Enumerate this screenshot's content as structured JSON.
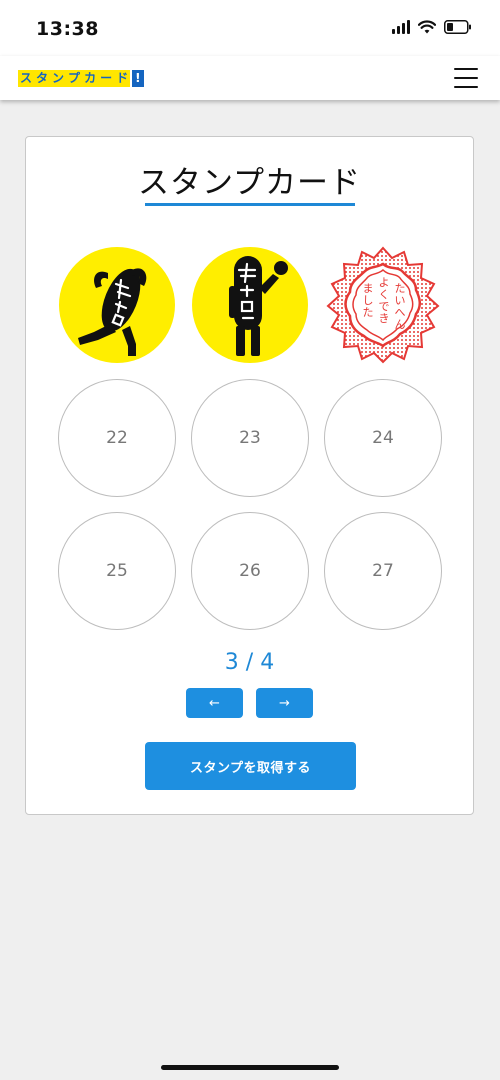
{
  "status_bar": {
    "time": "13:38"
  },
  "app_bar": {
    "logo_chars": [
      "ス",
      "タ",
      "ン",
      "プ",
      "カ",
      "ー",
      "ド"
    ],
    "logo_exclaim": "!",
    "menu_icon": "hamburger-icon"
  },
  "card": {
    "title": "スタンプカード",
    "stamps": [
      {
        "state": "stamped",
        "image": "running-character-stamp",
        "label": "サボロー"
      },
      {
        "state": "stamped",
        "image": "fist-up-character-stamp",
        "label": "サボロー"
      },
      {
        "state": "stamped",
        "image": "praise-seal-stamp",
        "label": "たいへんよくできました"
      },
      {
        "state": "empty",
        "number": "22"
      },
      {
        "state": "empty",
        "number": "23"
      },
      {
        "state": "empty",
        "number": "24"
      },
      {
        "state": "empty",
        "number": "25"
      },
      {
        "state": "empty",
        "number": "26"
      },
      {
        "state": "empty",
        "number": "27"
      }
    ],
    "pagination": {
      "text": "3 / 4",
      "prev_label": "←",
      "next_label": "→"
    },
    "get_stamp_label": "スタンプを取得する"
  },
  "colors": {
    "accent": "#1e8fe0",
    "stamp_yellow": "#ffee00",
    "seal_red": "#e53935"
  }
}
